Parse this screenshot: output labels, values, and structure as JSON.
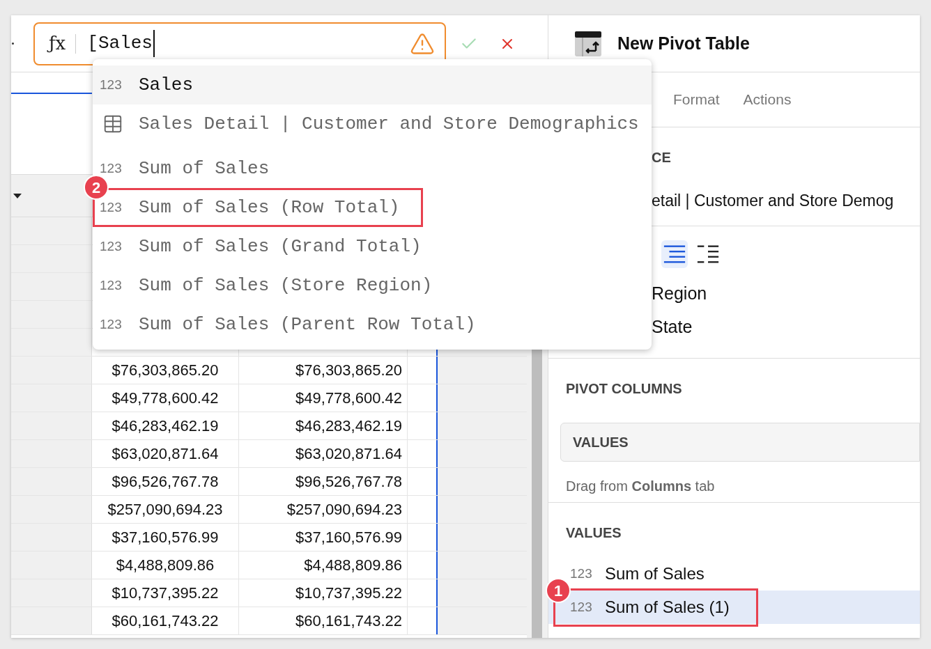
{
  "formula_bar": {
    "fx_label": "ƒx",
    "value": "[Sales",
    "warning": true
  },
  "suggestions": [
    {
      "kind": "field",
      "type_label": "123",
      "label": "Sales",
      "selected": true
    },
    {
      "kind": "table",
      "label": "Sales Detail | Customer and Store Demographics",
      "selected": false
    },
    {
      "kind": "field",
      "type_label": "123",
      "label": "Sum of Sales",
      "selected": false
    },
    {
      "kind": "field",
      "type_label": "123",
      "label": "Sum of Sales (Row Total)",
      "selected": false,
      "callout": "2"
    },
    {
      "kind": "field",
      "type_label": "123",
      "label": "Sum of Sales (Grand Total)",
      "selected": false
    },
    {
      "kind": "field",
      "type_label": "123",
      "label": "Sum of Sales (Store Region)",
      "selected": false
    },
    {
      "kind": "field",
      "type_label": "123",
      "label": "Sum of Sales (Parent Row Total)",
      "selected": false
    }
  ],
  "table": {
    "rows": [
      [
        "$76,303,865.20",
        "$76,303,865.20"
      ],
      [
        "$49,778,600.42",
        "$49,778,600.42"
      ],
      [
        "$46,283,462.19",
        "$46,283,462.19"
      ],
      [
        "$63,020,871.64",
        "$63,020,871.64"
      ],
      [
        "$96,526,767.78",
        "$96,526,767.78"
      ],
      [
        "$257,090,694.23",
        "$257,090,694.23"
      ],
      [
        "$37,160,576.99",
        "$37,160,576.99"
      ],
      [
        "$4,488,809.86",
        "$4,488,809.86"
      ],
      [
        "$10,737,395.22",
        "$10,737,395.22"
      ],
      [
        "$60,161,743.22",
        "$60,161,743.22"
      ]
    ]
  },
  "panel": {
    "title": "New Pivot Table",
    "tabs": [
      {
        "label": "Format",
        "selected": false
      },
      {
        "label": "Actions",
        "selected": false
      }
    ],
    "source": {
      "heading": "CE",
      "value": "etail | Customer and Store Demog"
    },
    "layout_options": [
      {
        "kind": "indented",
        "selected": true
      },
      {
        "kind": "tabular",
        "selected": false
      }
    ],
    "pivot_rows": [
      "Region",
      "State"
    ],
    "pivot_columns": {
      "heading": "PIVOT COLUMNS",
      "box_label": "VALUES",
      "hint": "Drag from **Columns** tab"
    },
    "values": {
      "heading": "VALUES",
      "items": [
        {
          "type_label": "123",
          "label": "Sum of Sales",
          "selected": false
        },
        {
          "type_label": "123",
          "label": "Sum of Sales (1)",
          "selected": true,
          "callout": "1"
        }
      ]
    }
  }
}
